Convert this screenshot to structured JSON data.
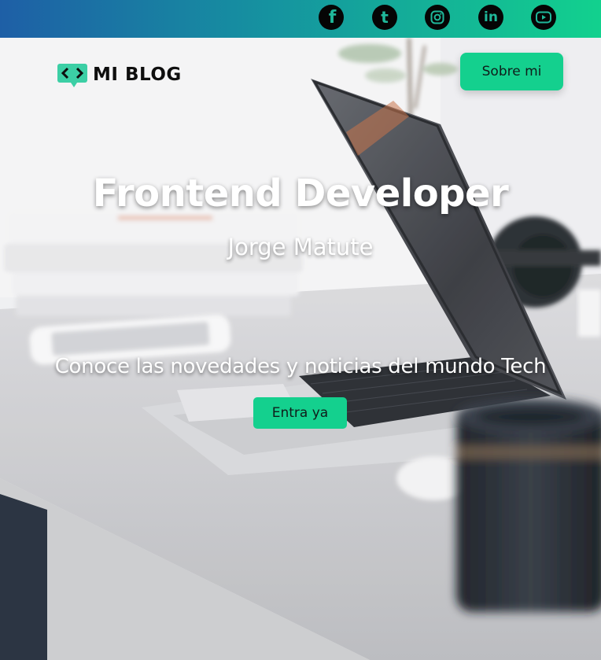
{
  "social": [
    {
      "name": "facebook",
      "icon": "facebook-icon",
      "glyph": "f"
    },
    {
      "name": "tumblr",
      "icon": "tumblr-icon",
      "glyph": "t"
    },
    {
      "name": "instagram",
      "icon": "instagram-icon",
      "glyph": ""
    },
    {
      "name": "linkedin",
      "icon": "linkedin-icon",
      "glyph": "in"
    },
    {
      "name": "youtube",
      "icon": "youtube-icon",
      "glyph": ""
    }
  ],
  "nav": {
    "logo_text": "MI BLOG",
    "logo_icon": "code-brackets-icon",
    "about_label": "Sobre mi"
  },
  "hero": {
    "headline": "Frontend Developer",
    "author": "Jorge Matute",
    "tagline": "Conoce las novedades y noticias del mundo Tech",
    "cta_label": "Entra ya"
  },
  "colors": {
    "accent": "#14d08e",
    "topbar_start": "#1e5fa6",
    "topbar_end": "#12d18e",
    "icon_bg": "#050505"
  }
}
